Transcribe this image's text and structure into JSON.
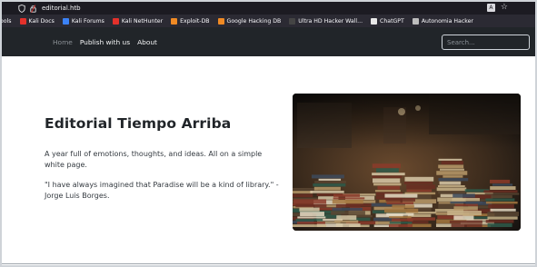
{
  "browser": {
    "url": "editorial.htb",
    "bookmarks": [
      {
        "label": "ools",
        "icon": "tools-icon",
        "color": "#888888"
      },
      {
        "label": "Kali Docs",
        "icon": "kali-docs-icon",
        "color": "#e4312b"
      },
      {
        "label": "Kali Forums",
        "icon": "kali-forums-icon",
        "color": "#3b82f6"
      },
      {
        "label": "Kali NetHunter",
        "icon": "kali-nethunter-icon",
        "color": "#e4312b"
      },
      {
        "label": "Exploit-DB",
        "icon": "exploit-db-icon",
        "color": "#f08a24"
      },
      {
        "label": "Google Hacking DB",
        "icon": "google-hacking-db-icon",
        "color": "#f08a24"
      },
      {
        "label": "Ultra HD Hacker Wall...",
        "icon": "wallpaper-icon",
        "color": "#444444"
      },
      {
        "label": "ChatGPT",
        "icon": "chatgpt-icon",
        "color": "#e8e8e8"
      },
      {
        "label": "Autonomia Hacker",
        "icon": "globe-icon",
        "color": "#bdbdbd"
      }
    ]
  },
  "navbar": {
    "links": [
      {
        "label": "Home",
        "active": false
      },
      {
        "label": "Publish with us",
        "active": true
      },
      {
        "label": "About",
        "active": true
      }
    ],
    "search_placeholder": "Search..."
  },
  "hero": {
    "title": "Editorial Tiempo Arriba",
    "text": "A year full of emotions, thoughts, and ideas. All on a simple white page.",
    "quote": "\"I have always imagined that Paradise will be a kind of library.\" - Jorge Luis Borges."
  }
}
